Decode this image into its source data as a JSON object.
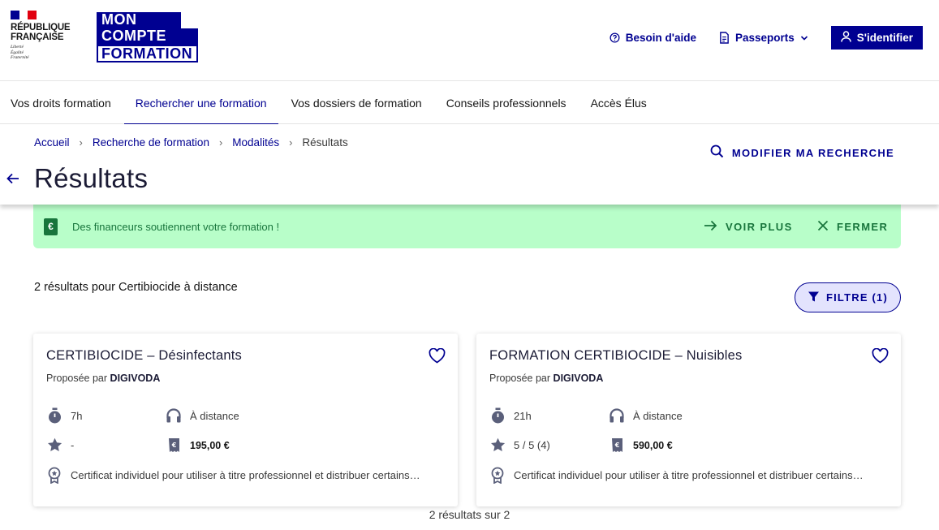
{
  "header": {
    "republique": "RÉPUBLIQUE\nFRANÇAISE",
    "motto": "Liberté\nÉgalité\nFraternité",
    "logo": {
      "line1": "MON",
      "line2": "COMPTE",
      "line3": "FORMATION"
    },
    "help": "Besoin d'aide",
    "passports": "Passeports",
    "signin": "S'identifier",
    "colors": {
      "primary": "#000091",
      "flag_blue": "#000091",
      "flag_red": "#e1000f"
    }
  },
  "nav": {
    "items": [
      "Vos droits formation",
      "Rechercher une formation",
      "Vos dossiers de formation",
      "Conseils professionnels",
      "Accès Élus"
    ],
    "active_index": 1
  },
  "breadcrumb": [
    "Accueil",
    "Recherche de formation",
    "Modalités",
    "Résultats"
  ],
  "page_title": "Résultats",
  "modify_search": "MODIFIER MA RECHERCHE",
  "banner": {
    "text": "Des financeurs soutiennent votre formation !",
    "more": "VOIR PLUS",
    "close": "FERMER",
    "color": "#b8fec9",
    "icon": "euro-icon"
  },
  "results": {
    "count_text": "2 résultats pour Certibiocide à distance",
    "filter_label": "FILTRE (1)",
    "footer": "2 résultats sur 2"
  },
  "cards": [
    {
      "title": "CERTIBIOCIDE – Désinfectants",
      "provider_prefix": "Proposée par",
      "provider": "DIGIVODA",
      "duration": "7h",
      "mode": "À distance",
      "rating": "-",
      "price": "195,00 €",
      "certification": "Certificat individuel pour utiliser à titre professionnel et distribuer certains…"
    },
    {
      "title": "FORMATION CERTIBIOCIDE – Nuisibles",
      "provider_prefix": "Proposée par",
      "provider": "DIGIVODA",
      "duration": "21h",
      "mode": "À distance",
      "rating": "5 / 5 (4)",
      "price": "590,00 €",
      "certification": "Certificat individuel pour utiliser à titre professionnel et distribuer certains…"
    }
  ]
}
